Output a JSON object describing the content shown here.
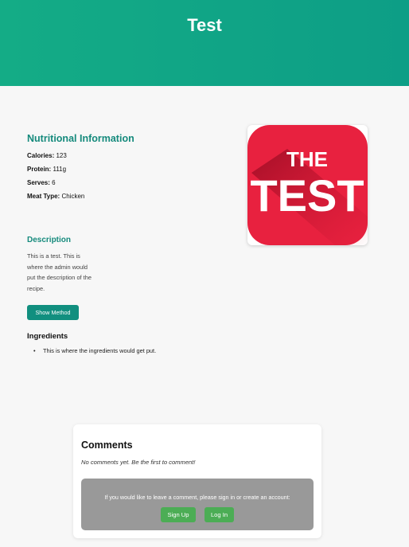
{
  "header": {
    "title": "Test"
  },
  "nutrition": {
    "title": "Nutritional Information",
    "rows": [
      {
        "label": "Calories:",
        "value": "123"
      },
      {
        "label": "Protein:",
        "value": "111g"
      },
      {
        "label": "Serves:",
        "value": "6"
      },
      {
        "label": "Meat Type:",
        "value": "Chicken"
      }
    ]
  },
  "recipe_image": {
    "line1": "THE",
    "line2": "TEST",
    "bg_color": "#e8213f"
  },
  "description": {
    "title": "Description",
    "lines": [
      "This is a test. This is",
      "where the admin would",
      "put the description of the",
      "recipe."
    ]
  },
  "method_button": {
    "label": "Show Method"
  },
  "ingredients": {
    "title": "Ingredients",
    "items": [
      "This is where the ingredients would get put."
    ]
  },
  "comments": {
    "title": "Comments",
    "empty_text": "No comments yet. Be the first to comment!",
    "signin_prompt": "If you would like to leave a comment, please sign in or create an account:",
    "signup_label": "Sign Up",
    "login_label": "Log In"
  }
}
